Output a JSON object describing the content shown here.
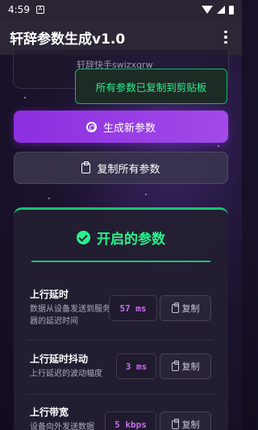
{
  "status_bar": {
    "time": "4:59",
    "notification": "A"
  },
  "app_bar": {
    "title": "轩辞参数生成v1.0",
    "menu_icon": "more-vert-icon"
  },
  "top_card": {
    "signature": "轩辞快手swizxqrw"
  },
  "toast": {
    "message": "所有参数已复制到剪贴板"
  },
  "actions": {
    "generate_label": "生成新参数",
    "copy_all_label": "复制所有参数"
  },
  "params_card": {
    "title": "开启的参数",
    "accent_color": "#2bf08b",
    "items": [
      {
        "name": "上行延时",
        "desc": "数据从设备发送到服务器的延迟时间",
        "value": "57 ms",
        "copy_label": "复制"
      },
      {
        "name": "上行延时抖动",
        "desc": "上行延迟的波动幅度",
        "value": "3 ms",
        "copy_label": "复制"
      },
      {
        "name": "上行带宽",
        "desc": "设备向外发送数据",
        "value": "5 kbps",
        "copy_label": "复制"
      }
    ]
  }
}
